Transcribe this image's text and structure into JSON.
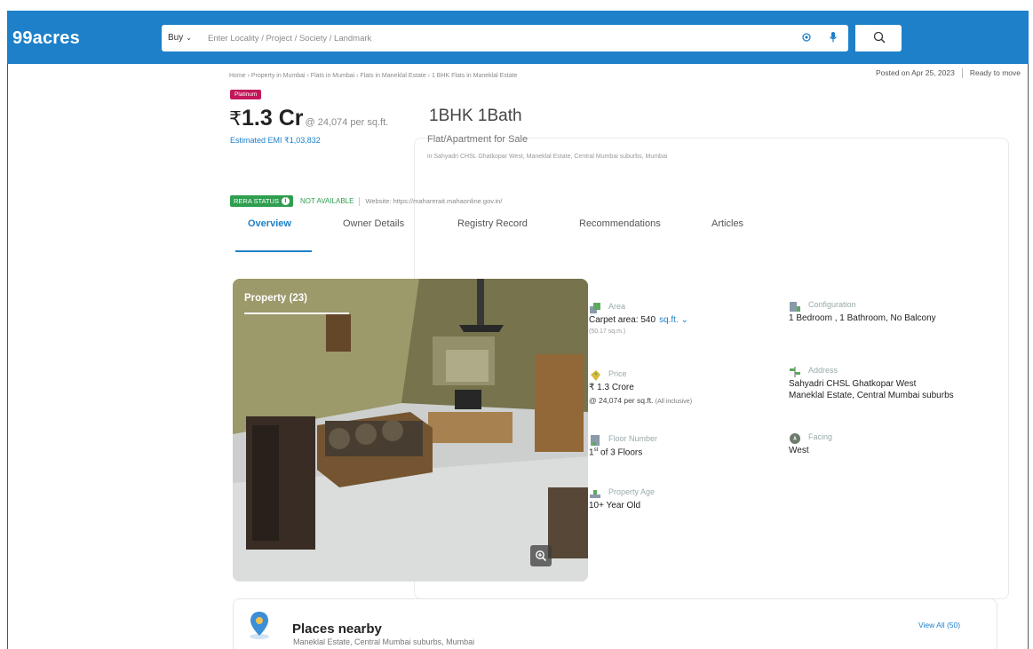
{
  "header": {
    "logo": "99acres",
    "buy_label": "Buy",
    "search_placeholder": "Enter Locality / Project / Society / Landmark"
  },
  "posted": {
    "date": "Posted on Apr 25, 2023",
    "status": "Ready to move"
  },
  "breadcrumb": "Home › Property in Mumbai › Flats in Mumbai › Flats in Maneklal Estate › 1 BHK Flats in Maneklal Estate",
  "badge": "Platinum",
  "price": {
    "currency": "₹",
    "amount": "1.3 Cr",
    "per_sqft": "@ 24,074 per sq.ft.",
    "emi": "Estimated EMI ₹1,03,832"
  },
  "config": {
    "title": "1BHK 1Bath",
    "type": "Flat/Apartment for Sale",
    "address": "in Sahyadri CHSL Ghatkopar West, Maneklal Estate, Central Mumbai suburbs, Mumbai"
  },
  "rera": {
    "label": "RERA STATUS",
    "info_glyph": "i",
    "status": "NOT AVAILABLE",
    "website": "Website: https://maharerait.mahaonline.gov.in/"
  },
  "tabs": [
    {
      "label": "Overview",
      "active": true
    },
    {
      "label": "Owner Details",
      "active": false
    },
    {
      "label": "Registry Record",
      "active": false
    },
    {
      "label": "Recommendations",
      "active": false
    },
    {
      "label": "Articles",
      "active": false
    }
  ],
  "photo": {
    "title": "Property (23)"
  },
  "details": {
    "area": {
      "label": "Area",
      "value": "Carpet area: 540",
      "unit": "sq.ft.",
      "sub": "(50.17 sq.m.)"
    },
    "configuration": {
      "label": "Configuration",
      "value": "1 Bedroom , 1 Bathroom, No Balcony"
    },
    "price": {
      "label": "Price",
      "value": "₹ 1.3 Crore",
      "sub": "@ 24,074 per sq.ft.",
      "sub_note": "(All inclusive)"
    },
    "address": {
      "label": "Address",
      "line1": "Sahyadri CHSL Ghatkopar West",
      "line2": "Maneklal Estate, Central Mumbai suburbs"
    },
    "floor": {
      "label": "Floor Number",
      "value_num": "1",
      "value_sup": "st",
      "value_rest": "of 3 Floors"
    },
    "facing": {
      "label": "Facing",
      "value": "West"
    },
    "age": {
      "label": "Property Age",
      "value": "10+ Year Old"
    }
  },
  "places": {
    "title": "Places nearby",
    "subtitle": "Maneklal Estate, Central Mumbai suburbs, Mumbai",
    "view_all": "View All (50)"
  },
  "colors": {
    "brand_blue": "#1d80c9",
    "rera_green": "#2e9e4f",
    "badge_magenta": "#c2185b"
  },
  "icons": [
    "location-target-icon",
    "microphone-icon",
    "search-icon",
    "info-icon",
    "zoom-icon",
    "area-icon",
    "configuration-icon",
    "price-icon",
    "address-icon",
    "floor-icon",
    "facing-icon",
    "property-age-icon",
    "map-pin-icon"
  ]
}
